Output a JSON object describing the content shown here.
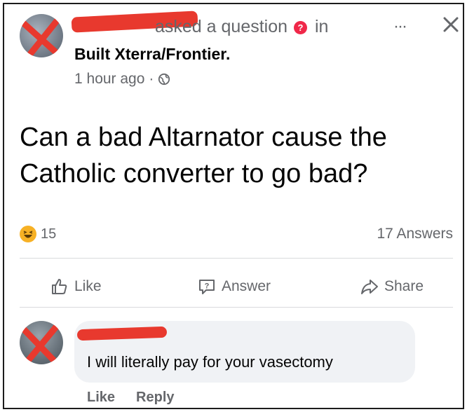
{
  "post": {
    "header_text": "asked a question",
    "in_text": "in",
    "group_name": "Built Xterra/Frontier.",
    "time": "1 hour ago",
    "separator": "·",
    "more_label": "···",
    "question": "Can a bad Altarnator cause the Catholic converter to go bad?",
    "reaction_count": "15",
    "answers_count": "17 Answers"
  },
  "actions": {
    "like": "Like",
    "answer": "Answer",
    "share": "Share"
  },
  "comment": {
    "text": "I will literally pay for your vasectomy",
    "like": "Like",
    "reply": "Reply"
  },
  "colors": {
    "redaction": "#e8392e",
    "question_icon": "#f02849",
    "muted_text": "#65676b",
    "bubble": "#f0f2f5"
  },
  "icons": [
    "question-badge-icon",
    "globe-icon",
    "more-icon",
    "close-icon",
    "haha-reaction-icon",
    "like-icon",
    "answer-icon",
    "share-icon"
  ]
}
